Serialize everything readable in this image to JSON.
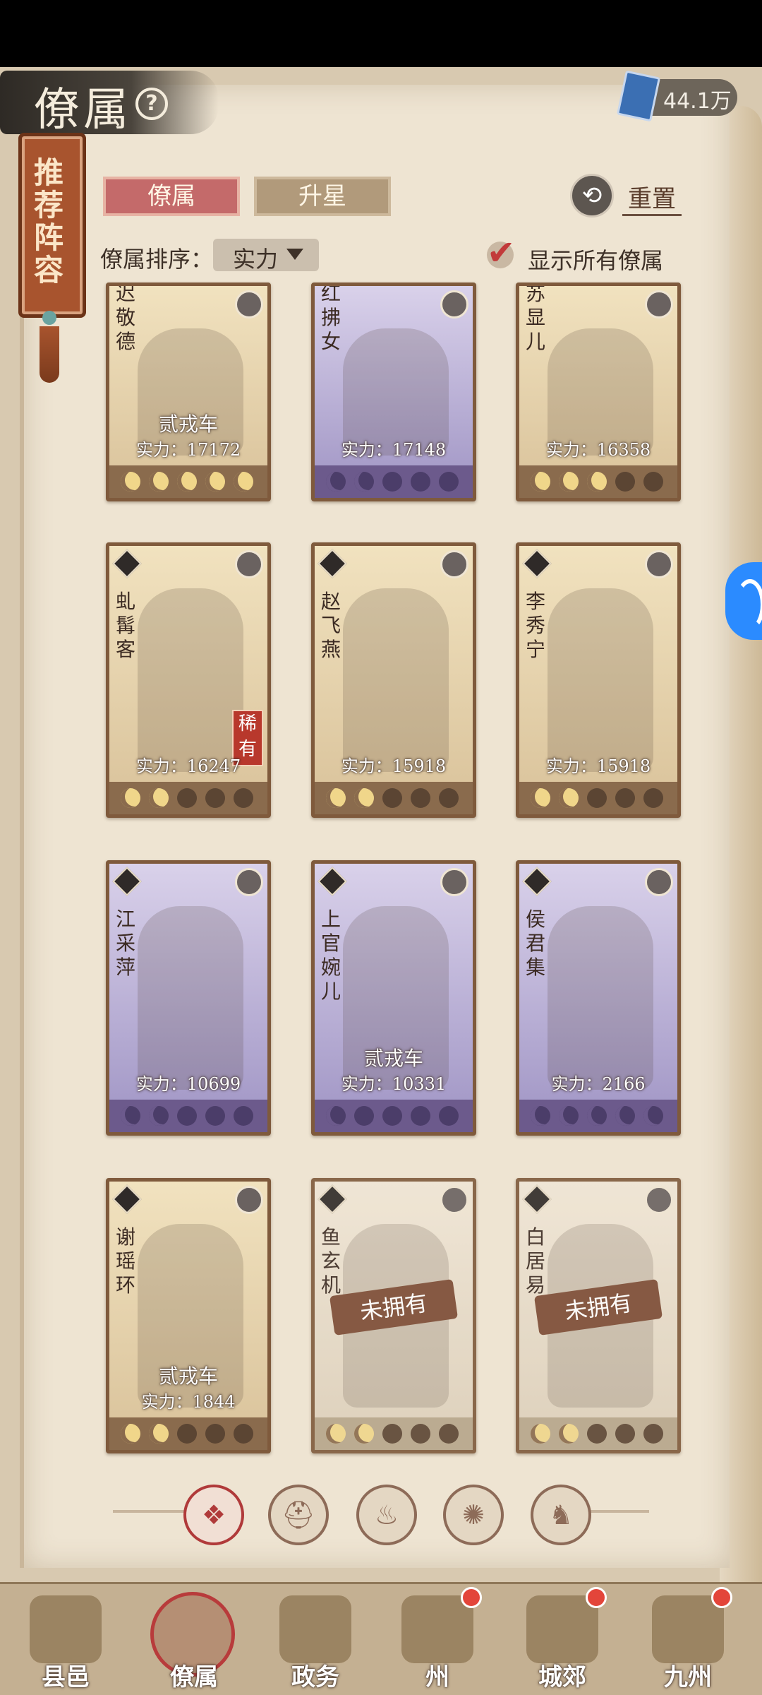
{
  "header": {
    "title": "僚属",
    "help_icon": "help-icon",
    "currency": {
      "icon": "book-icon",
      "value": "44.1万"
    }
  },
  "recommend_tab": {
    "label": "推荐阵容"
  },
  "tabs": [
    {
      "label": "僚属",
      "active": true
    },
    {
      "label": "升星",
      "active": false
    }
  ],
  "reset": {
    "icon": "reset-icon",
    "label": "重置"
  },
  "sort": {
    "label": "僚属排序：",
    "value": "实力"
  },
  "show_all": {
    "label": "显示所有僚属",
    "checked": true
  },
  "cards": [
    {
      "name": "迟敬德",
      "title": "贰戎车",
      "power": "实力：17172",
      "stars": 5,
      "tier": "gold",
      "owned": true,
      "rare": ""
    },
    {
      "name": "红拂女",
      "title": "",
      "power": "实力：17148",
      "stars": 2,
      "tier": "purple",
      "owned": true,
      "rare": ""
    },
    {
      "name": "苏显儿",
      "title": "",
      "power": "实力：16358",
      "stars": 3,
      "tier": "gold",
      "owned": true,
      "rare": ""
    },
    {
      "name": "虬髯客",
      "title": "",
      "power": "实力：16247",
      "stars": 2,
      "tier": "gold",
      "owned": true,
      "rare": "稀有"
    },
    {
      "name": "赵飞燕",
      "title": "",
      "power": "实力：15918",
      "stars": 2,
      "tier": "gold",
      "owned": true,
      "rare": ""
    },
    {
      "name": "李秀宁",
      "title": "",
      "power": "实力：15918",
      "stars": 2,
      "tier": "gold",
      "owned": true,
      "rare": ""
    },
    {
      "name": "江采萍",
      "title": "",
      "power": "实力：10699",
      "stars": 2,
      "tier": "purple",
      "owned": true,
      "rare": ""
    },
    {
      "name": "上官婉儿",
      "title": "贰戎车",
      "power": "实力：10331",
      "stars": 1,
      "tier": "purple",
      "owned": true,
      "rare": ""
    },
    {
      "name": "侯君集",
      "title": "",
      "power": "实力：2166",
      "stars": 5,
      "tier": "purple",
      "owned": true,
      "rare": ""
    },
    {
      "name": "谢瑶环",
      "title": "贰戎车",
      "power": "实力：1844",
      "stars": 2,
      "tier": "gold",
      "owned": true,
      "rare": ""
    },
    {
      "name": "鱼玄机",
      "title": "",
      "power": "",
      "stars": 2,
      "tier": "locked",
      "owned": false,
      "unowned_label": "未拥有",
      "rare": ""
    },
    {
      "name": "白居易",
      "title": "",
      "power": "",
      "stars": 2,
      "tier": "locked",
      "owned": false,
      "unowned_label": "未拥有",
      "rare": ""
    }
  ],
  "filters": [
    {
      "icon": "all-filter-icon",
      "glyph": "❖",
      "active": true
    },
    {
      "icon": "helmet-filter-icon",
      "glyph": "⛑",
      "active": false
    },
    {
      "icon": "gourd-filter-icon",
      "glyph": "♨",
      "active": false
    },
    {
      "icon": "fan-filter-icon",
      "glyph": "✺",
      "active": false
    },
    {
      "icon": "beast-filter-icon",
      "glyph": "♞",
      "active": false
    }
  ],
  "nav": [
    {
      "label": "县邑",
      "icon": "county-icon",
      "dot": false,
      "active": false
    },
    {
      "label": "僚属",
      "icon": "retainer-icon",
      "dot": false,
      "active": true
    },
    {
      "label": "政务",
      "icon": "affairs-icon",
      "dot": false,
      "active": false
    },
    {
      "label": "州",
      "icon": "province-icon",
      "dot": true,
      "active": false
    },
    {
      "label": "城郊",
      "icon": "suburb-icon",
      "dot": true,
      "active": false
    },
    {
      "label": "九州",
      "icon": "map-icon",
      "dot": true,
      "active": false
    }
  ],
  "colors": {
    "paper": "#eee4d2",
    "accent_red": "#c46a6a",
    "gold_card": "#d9c29a",
    "purple_card": "#9f94c4"
  }
}
